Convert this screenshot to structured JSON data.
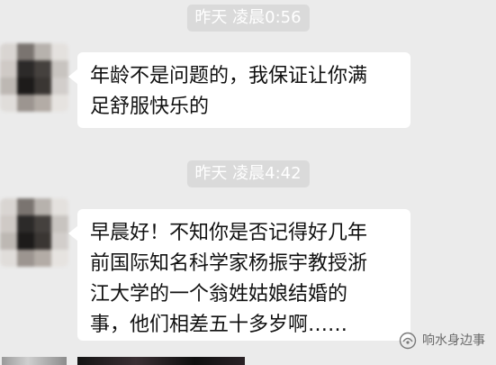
{
  "messages": [
    {
      "timestamp": "昨天 凌晨0:56",
      "lines": [
        "年龄不是问题的，我保证让你满",
        "足舒服快乐的"
      ]
    },
    {
      "timestamp": "昨天 凌晨4:42",
      "lines": [
        "早晨好！不知你是否记得好几年",
        "前国际知名科学家杨振宇教授浙",
        "江大学的一个翁姓姑娘结婚的",
        "事，他们相差五十多岁啊……"
      ]
    }
  ],
  "watermark": {
    "text": "响水身边事",
    "icon": "wechat-channel-icon"
  },
  "colors": {
    "background": "#ebebeb",
    "bubble": "#ffffff",
    "timestamp_bg": "#dadada",
    "timestamp_text": "#ffffff",
    "text": "#111111"
  }
}
